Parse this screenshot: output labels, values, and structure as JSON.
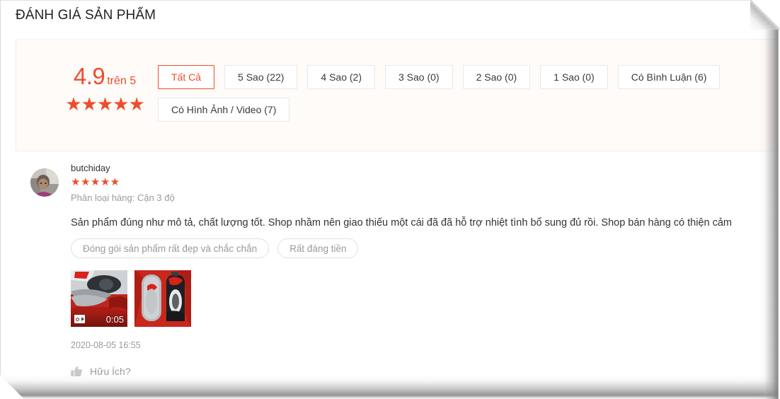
{
  "page": {
    "title": "ĐÁNH GIÁ SẢN PHẨM"
  },
  "colors": {
    "accent": "#ee4d2d",
    "panel_bg": "#fffbf8",
    "muted_text": "#9b9b9b",
    "body_text": "#333333"
  },
  "summary": {
    "score": "4.9",
    "out_of_label": "trên 5",
    "stars_glyphs": "★★★★★",
    "star_count": 5
  },
  "filters": [
    {
      "label": "Tất Cả",
      "active": true
    },
    {
      "label": "5 Sao (22)",
      "active": false
    },
    {
      "label": "4 Sao (2)",
      "active": false
    },
    {
      "label": "3 Sao (0)",
      "active": false
    },
    {
      "label": "2 Sao (0)",
      "active": false
    },
    {
      "label": "1 Sao (0)",
      "active": false
    },
    {
      "label": "Có Bình Luận (6)",
      "active": false
    },
    {
      "label": "Có Hình Ảnh / Video (7)",
      "active": false
    }
  ],
  "review": {
    "avatar_name": "user-avatar",
    "username": "butchiday",
    "stars_glyphs": "★★★★★",
    "star_count": 5,
    "variation": "Phân loại hàng: Cận 3 độ",
    "text": "Sản phẩm đúng như mô tả, chất lượng tốt. Shop nhầm nên giao thiếu một cái đã đã hỗ trợ nhiệt tình bổ sung đủ rồi. Shop bán hàng có thiện cảm",
    "tags": [
      "Đóng gói sản phẩm rất đẹp và chắc chắn",
      "Rất đáng tiền"
    ],
    "media": [
      {
        "type": "video",
        "duration": "0:05",
        "icon": "video-camera-icon"
      },
      {
        "type": "image",
        "duration": "",
        "icon": ""
      }
    ],
    "timestamp": "2020-08-05 16:55",
    "helpful_label": "Hữu Ích?",
    "helpful_icon": "thumbs-up-icon"
  }
}
